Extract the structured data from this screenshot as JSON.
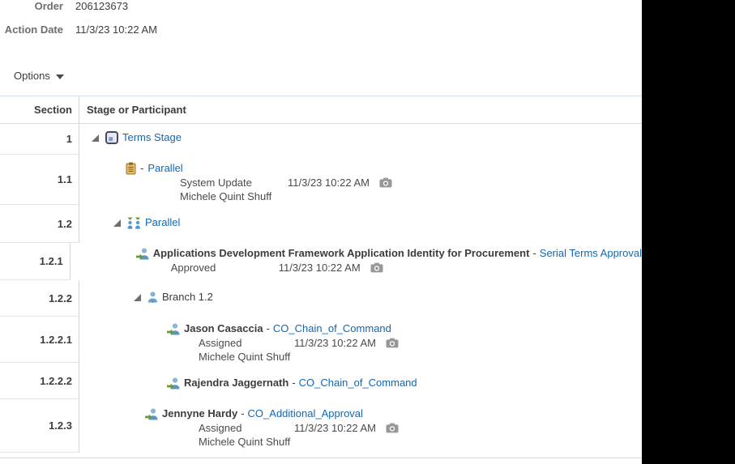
{
  "header": {
    "fields": [
      {
        "label": "Order",
        "value": "206123673"
      },
      {
        "label": "Action Date",
        "value": "11/3/23 10:22 AM"
      }
    ],
    "options_label": "Options"
  },
  "table": {
    "columns": {
      "section": "Section",
      "stage": "Stage or Participant"
    },
    "rows": [
      {
        "section": "1",
        "icon": "stage-icon",
        "link": "Terms Stage"
      },
      {
        "section": "1.1",
        "icon": "clipboard-icon",
        "prefix": "-",
        "link": "Parallel",
        "status": "System Update",
        "date": "11/3/23 10:22 AM",
        "person": "Michele Quint Shuff"
      },
      {
        "section": "1.2",
        "icon": "parallel-icon",
        "link": "Parallel"
      },
      {
        "section": "1.2.1",
        "icon": "participant-icon",
        "name": "Applications Development Framework Application Identity for Procurement",
        "sep": "-",
        "link": "Serial Terms Approval",
        "status": "Approved",
        "date": "11/3/23 10:22 AM"
      },
      {
        "section": "1.2.2",
        "icon": "person-icon",
        "text": "Branch 1.2"
      },
      {
        "section": "1.2.2.1",
        "icon": "participant-icon",
        "name": "Jason Casaccia",
        "sep": "-",
        "link": "CO_Chain_of_Command",
        "status": "Assigned",
        "date": "11/3/23 10:22 AM",
        "person": "Michele Quint Shuff"
      },
      {
        "section": "1.2.2.2",
        "icon": "participant-icon",
        "name": "Rajendra Jaggernath",
        "sep": "-",
        "link": "CO_Chain_of_Command"
      },
      {
        "section": "1.2.3",
        "icon": "participant-icon",
        "name": "Jennyne Hardy",
        "sep": "-",
        "link": "CO_Additional_Approval",
        "status": "Assigned",
        "date": "11/3/23 10:22 AM",
        "person": "Michele Quint Shuff"
      }
    ]
  },
  "icons": {
    "stage-icon": "dark rounded square stage marker",
    "clipboard-icon": "tan clipboard task",
    "parallel-icon": "two people with green chevrons",
    "person-icon": "single blue person",
    "participant-icon": "blue person with green inbound arrow",
    "camera-icon": "gray snapshot camera",
    "expand-toggle-icon": "gray expanded-node triangle",
    "caret-down-icon": "dark dropdown caret"
  },
  "colors": {
    "link": "#1467b0",
    "label_gray": "#6e6e6e",
    "body_text": "#3c3c3c",
    "side_panel": "#000000",
    "row_border": "#e2e2e2",
    "header_border": "#d7e1e9"
  }
}
